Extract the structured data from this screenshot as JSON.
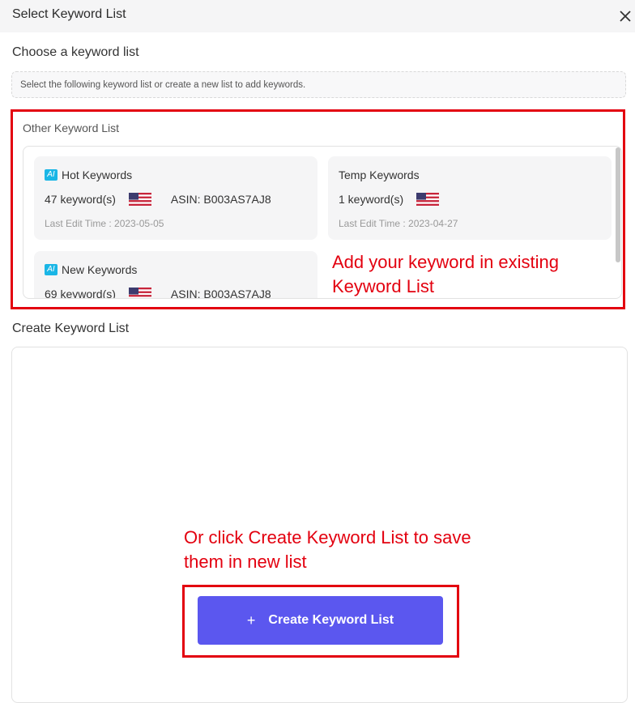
{
  "dialog": {
    "title": "Select Keyword List",
    "close_icon": "close-icon"
  },
  "choose": {
    "title": "Choose a keyword list",
    "hint": "Select the following keyword list or create a new list to add keywords."
  },
  "other_list": {
    "title": "Other Keyword List",
    "cards": [
      {
        "ai": "AI",
        "name": "Hot Keywords",
        "count": "47 keyword(s)",
        "asin": "ASIN: B003AS7AJ8",
        "time": "Last Edit Time : 2023-05-05"
      },
      {
        "ai": "",
        "name": "Temp Keywords",
        "count": "1 keyword(s)",
        "asin": "",
        "time": "Last Edit Time : 2023-04-27"
      },
      {
        "ai": "AI",
        "name": "New Keywords",
        "count": "69 keyword(s)",
        "asin": "ASIN: B003AS7AJ8",
        "time": ""
      }
    ]
  },
  "annotations": {
    "existing_line1": "Add your keyword in existing",
    "existing_line2": "Keyword List",
    "create_line1": "Or click Create Keyword List to save",
    "create_line2": "them in new list"
  },
  "create": {
    "title": "Create Keyword List",
    "button_plus": "+",
    "button_label": "Create Keyword List"
  },
  "colors": {
    "accent": "#5b57ef",
    "annotation": "#e3000f",
    "ai_badge": "#1ab6e6"
  }
}
